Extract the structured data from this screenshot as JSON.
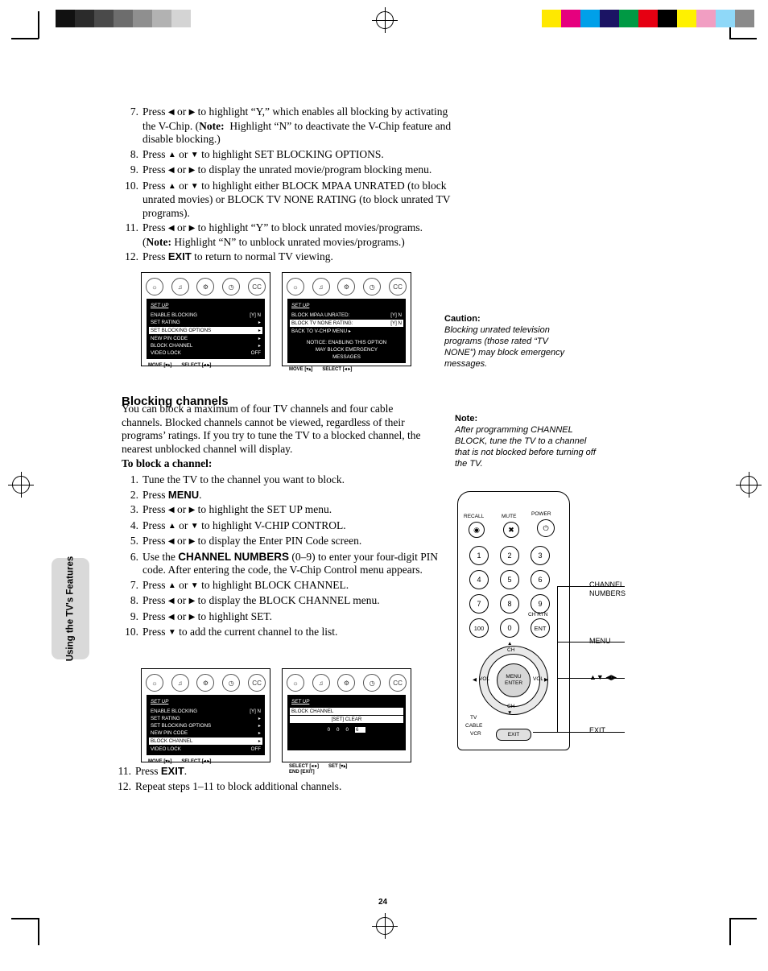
{
  "page_number": "24",
  "side_tab": "Using the TV's Features",
  "top_steps": [
    {
      "n": "7.",
      "text": "Press ◀ or ▶ to highlight “Y,” which enables all blocking by activating the V-Chip. (Note:  Highlight “N” to deactivate the V-Chip feature and disable blocking.)"
    },
    {
      "n": "8.",
      "text": "Press ▲ or ▼ to highlight SET BLOCKING OPTIONS."
    },
    {
      "n": "9.",
      "text": "Press ◀ or ▶ to display the unrated movie/program blocking menu."
    },
    {
      "n": "10.",
      "text": "Press ▲ or ▼ to highlight either BLOCK MPAA UNRATED (to block unrated movies) or BLOCK TV NONE RATING (to block unrated TV programs)."
    },
    {
      "n": "11.",
      "text": "Press ◀ or ▶ to highlight “Y” to block unrated movies/programs. (Note: Highlight “N” to unblock unrated movies/programs.)"
    },
    {
      "n": "12.",
      "text": "Press EXIT to return to normal TV viewing."
    }
  ],
  "caution": {
    "heading": "Caution:",
    "text": "Blocking unrated television programs (those rated “TV NONE”) may block emergency messages."
  },
  "note": {
    "heading": "Note:",
    "text": "After programming CHANNEL BLOCK, tune the TV to a channel that is not blocked before turning off the TV."
  },
  "section": {
    "title": "Blocking channels",
    "intro": "You can block a maximum of four TV channels and four cable channels. Blocked channels cannot be viewed, regardless of their programs’ ratings. If you try to tune the TV to a blocked channel, the nearest unblocked channel will display.",
    "subhead": "To block a channel:"
  },
  "block_steps": [
    {
      "n": "1.",
      "text": "Tune the TV to the channel you want to block."
    },
    {
      "n": "2.",
      "text": "Press MENU."
    },
    {
      "n": "3.",
      "text": "Press ◀ or ▶ to highlight the SET UP menu."
    },
    {
      "n": "4.",
      "text": "Press ▲ or ▼ to highlight V-CHIP CONTROL."
    },
    {
      "n": "5.",
      "text": "Press ◀ or ▶ to display the Enter PIN Code screen."
    },
    {
      "n": "6.",
      "text": "Use the CHANNEL NUMBERS (0–9) to enter your four-digit PIN code. After entering the code, the V-Chip Control menu appears."
    },
    {
      "n": "7.",
      "text": "Press ▲ or ▼ to highlight BLOCK CHANNEL."
    },
    {
      "n": "8.",
      "text": "Press ◀ or ▶ to display the BLOCK CHANNEL menu."
    },
    {
      "n": "9.",
      "text": "Press ◀ or ▶ to highlight SET."
    },
    {
      "n": "10.",
      "text": "Press ▼ to add the current channel to the list."
    }
  ],
  "block_steps_end": [
    {
      "n": "11.",
      "text": "Press EXIT."
    },
    {
      "n": "12.",
      "text": "Repeat steps 1–11 to block additional channels."
    }
  ],
  "osd_icons": [
    "picture-icon",
    "audio-icon",
    "setup-icon",
    "timer-icon",
    "cc-icon"
  ],
  "osd1": {
    "title": "SET UP",
    "rows": [
      {
        "label": "ENABLE BLOCKING",
        "value": "[Y] N",
        "hl": false
      },
      {
        "label": "SET RATING",
        "value": "▸",
        "hl": false
      },
      {
        "label": "SET BLOCKING OPTIONS",
        "value": "▸",
        "hl": true
      },
      {
        "label": "NEW PIN CODE",
        "value": "▸",
        "hl": false
      },
      {
        "label": "BLOCK CHANNEL",
        "value": "▸",
        "hl": false
      },
      {
        "label": "VIDEO LOCK",
        "value": "OFF",
        "hl": false
      }
    ],
    "foot_left": "MOVE [▾▴]",
    "foot_right": "SELECT [◂ ▸]"
  },
  "osd2": {
    "title": "SET UP",
    "rows": [
      {
        "label": "BLOCK MPAA UNRATED:",
        "value": "[Y]  N",
        "hl": false
      },
      {
        "label": "BLOCK TV NONE RATING:",
        "value": "[Y]  N",
        "hl": true
      },
      {
        "label": "BACK TO V-CHIP MENU ▸",
        "value": "",
        "hl": false
      }
    ],
    "notice": [
      "NOTICE:  ENABLING THIS OPTION",
      "MAY BLOCK EMERGENCY",
      "MESSAGES"
    ],
    "foot_left": "MOVE [▾▴]",
    "foot_right": "SELECT [◂ ▸]"
  },
  "osd3": {
    "title": "SET UP",
    "rows": [
      {
        "label": "ENABLE BLOCKING",
        "value": "[Y] N",
        "hl": false
      },
      {
        "label": "SET RATING",
        "value": "▸",
        "hl": false
      },
      {
        "label": "SET BLOCKING OPTIONS",
        "value": "▸",
        "hl": false
      },
      {
        "label": "NEW PIN CODE",
        "value": "▸",
        "hl": false
      },
      {
        "label": "BLOCK CHANNEL",
        "value": "▸",
        "hl": true
      },
      {
        "label": "VIDEO LOCK",
        "value": "OFF",
        "hl": false
      }
    ],
    "foot_left": "MOVE [▾▴]",
    "foot_right": "SELECT [◂ ▸]"
  },
  "osd4": {
    "title": "SET UP",
    "header": "BLOCK CHANNEL",
    "subheader": "[SET]  CLEAR",
    "digits": [
      "0",
      "0",
      "0",
      "6"
    ],
    "foot_left": "SELECT [◂ ▸]",
    "foot_right": "SET [▾▴]",
    "foot_end": "END [EXIT]"
  },
  "remote": {
    "top_labels": [
      "RECALL",
      "MUTE",
      "POWER"
    ],
    "keypad": [
      "1",
      "2",
      "3",
      "4",
      "5",
      "6",
      "7",
      "8",
      "9",
      "100",
      "0",
      "ENT"
    ],
    "ch_rtn": "CH RTN",
    "center": [
      "MENU",
      "ENTER"
    ],
    "ch_up": "CH",
    "ch_dn": "CH",
    "vol_left": "VOL",
    "vol_right": "VOL",
    "exit": "EXIT",
    "tv": "TV",
    "cable": "CABLE",
    "vcr": "VCR",
    "callouts": [
      {
        "id": "channel-numbers",
        "text": "CHANNEL\nNUMBERS"
      },
      {
        "id": "menu",
        "text": "MENU"
      },
      {
        "id": "arrows",
        "text": "▲▼ ◀▶"
      },
      {
        "id": "exit",
        "text": "EXIT"
      }
    ]
  },
  "colorbar_left": [
    "#111111",
    "#2b2b2b",
    "#4a4a4a",
    "#6d6d6d",
    "#8f8f8f",
    "#b2b2b2",
    "#d4d4d4",
    "#ffffff"
  ],
  "colorbar_right": [
    "#ffe800",
    "#e6007e",
    "#00a0e9",
    "#1b1464",
    "#009944",
    "#e60012",
    "#000000",
    "#fff100",
    "#f19ec2",
    "#8fd8f8",
    "#8a8a8a"
  ]
}
